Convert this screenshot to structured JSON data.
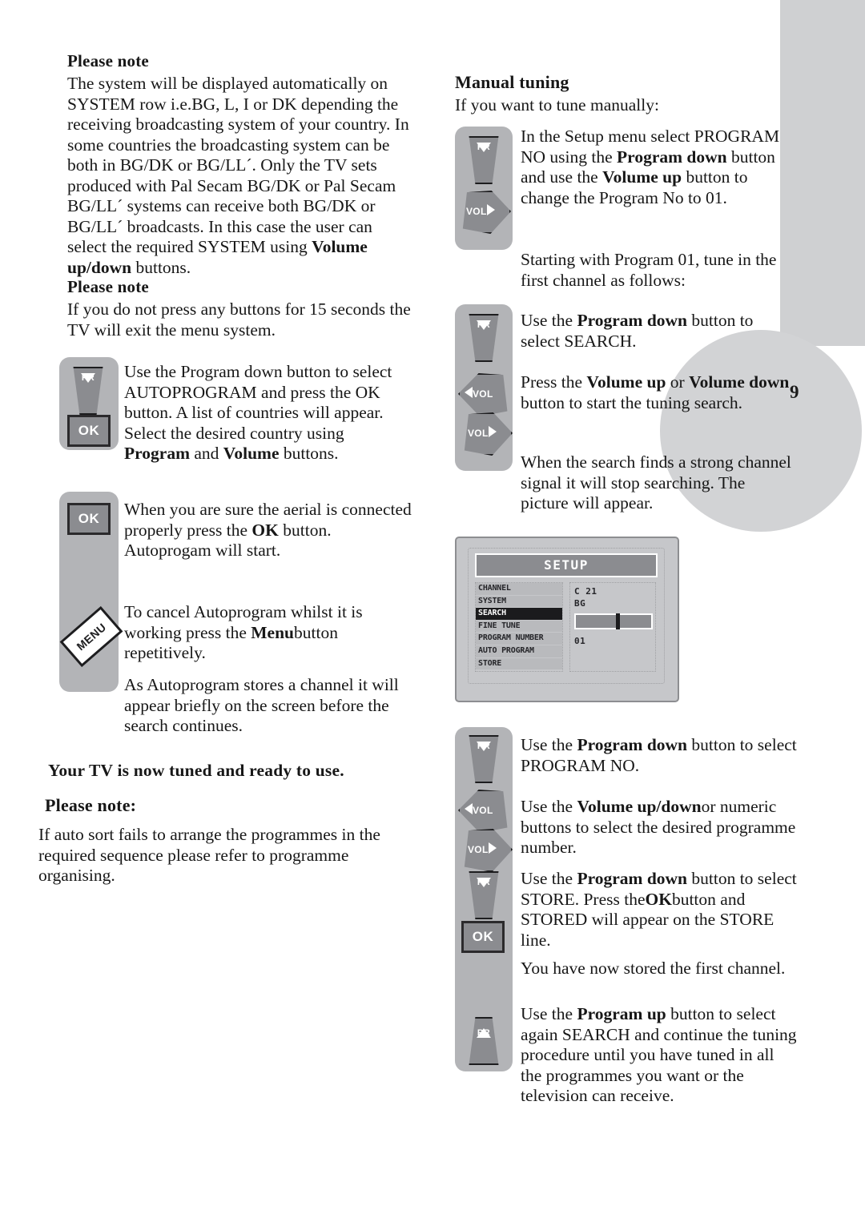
{
  "page": {
    "number": "9"
  },
  "left_column": {
    "note1": {
      "heading": "Please note",
      "body": "The system will be displayed automatically on SYSTEM row i.e.BG, L, I or DK depending the receiving broadcasting system of your country. In some countries the broadcasting system can be both in BG/DK or BG/LL´. Only the TV sets produced with Pal Secam BG/DK or Pal Secam BG/LL´ systems can receive both BG/DK or BG/LL´ broadcasts. In this case the user can select  the required SYSTEM using ",
      "body_bold": "Volume up/down",
      "body_tail": " buttons."
    },
    "note2": {
      "heading": "Please note",
      "body": "If you do not press any buttons for 15 seconds the TV will exit the menu system."
    },
    "step_autoprogram": {
      "text_part1": "Use the Program down  button to select AUTOPROGRAM and press the OK button.  A list of countries will appear.  Select the desired country using",
      "bold1": "Program",
      "mid1": " and ",
      "bold2": "Volume",
      "tail1": "  buttons."
    },
    "step_aerial": {
      "text_part1": "When you are sure the aerial is connected properly press the  ",
      "bold1": "OK",
      "tail1": " button. Autoprogam will start."
    },
    "step_cancel": {
      "text_part1": "To cancel Autoprogram whilst it is working press the ",
      "bold1": "Menu",
      "tail1": "button repetitively."
    },
    "step_stores": {
      "text": "As Autoprogram stores a channel it will appear briefly on the screen before the search continues."
    },
    "tuned_heading": "Your TV is now tuned and ready to use.",
    "note3": {
      "heading": "Please note:",
      "body": "If auto sort fails to arrange the programmes in the required sequence please refer to programme organising."
    },
    "buttons": {
      "pr_down_label": "PR",
      "ok_label": "OK",
      "menu_label": "MENU"
    }
  },
  "right_column": {
    "heading": "Manual tuning",
    "subheading": "If you want to tune manually:",
    "step_setup": {
      "part1": "In the Setup menu select PROGRAM NO using the ",
      "bold1": "Program down",
      "mid1": " button and use the ",
      "bold2": "Volume up",
      "tail1": " button to change the Program No to 01."
    },
    "step_start": {
      "text": "Starting with Program 01, tune in the first channel as follows:"
    },
    "step_search": {
      "part1": "Use the ",
      "bold1": "Program down",
      "tail1": " button to select SEARCH."
    },
    "step_press_vol": {
      "part1": "Press the ",
      "bold1": "Volume up",
      "mid1": " or ",
      "bold2": "Volume down",
      "tail1": " button to start the tuning search."
    },
    "step_found": {
      "text": "When the search finds a strong channel signal it will stop searching. The picture will appear."
    },
    "step_program_no": {
      "part1": "Use the ",
      "bold1": "Program down",
      "tail1": " button to select PROGRAM NO."
    },
    "step_numeric": {
      "part1": "Use the ",
      "bold1": "Volume up/down",
      "tail1": "or numeric buttons to select the desired programme number."
    },
    "step_store": {
      "part1": "Use the ",
      "bold1": "Program down",
      "mid1": "  button to select STORE. Press the",
      "bold2": "OK",
      "tail1": "button and STORED will appear on the STORE line."
    },
    "step_stored_first": {
      "text": "You have now stored the first channel."
    },
    "step_repeat": {
      "part1": "Use the  ",
      "bold1": "Program up",
      "tail1": " button to select again SEARCH and continue the tuning procedure until you have tuned in all the programmes you want or the television can receive."
    },
    "buttons": {
      "pr_down_label": "PR",
      "pr_up_label": "PR",
      "vol_right_label": "VOL",
      "vol_left_label": "VOL",
      "ok_label": "OK"
    }
  },
  "osd": {
    "title": "SETUP",
    "menu_items": [
      {
        "label": "CHANNEL",
        "selected": false
      },
      {
        "label": "SYSTEM",
        "selected": false
      },
      {
        "label": "SEARCH",
        "selected": true
      },
      {
        "label": "FINE TUNE",
        "selected": false
      },
      {
        "label": "PROGRAM NUMBER",
        "selected": false
      },
      {
        "label": "AUTO PROGRAM",
        "selected": false
      },
      {
        "label": "STORE",
        "selected": false
      }
    ],
    "values": {
      "channel": "C 21",
      "system": "BG",
      "program_number": "01"
    }
  },
  "colors": {
    "strip_gray": "#b3b4b7",
    "button_gray": "#8b8c90",
    "decor_gray": "#d2d3d5",
    "osd_body": "#c6c7ca",
    "osd_selected": "#1b1b1d"
  }
}
